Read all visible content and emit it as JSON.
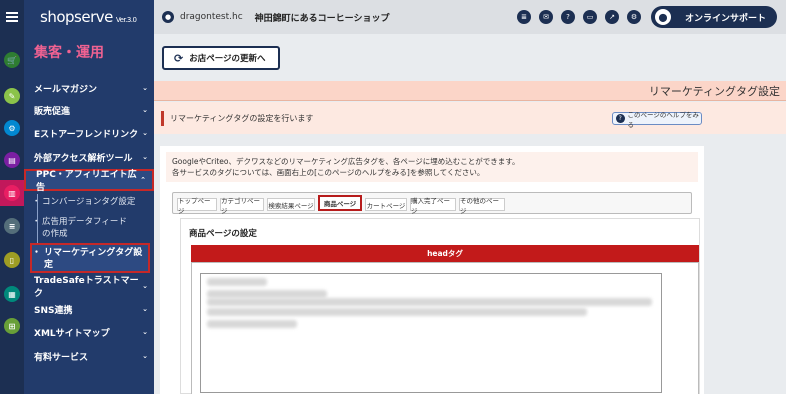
{
  "brand": {
    "name": "shopserve",
    "version": "Ver.3.0"
  },
  "section_title": "集客・運用",
  "header": {
    "user": "dragontest.hc",
    "shop": "神田錦町にあるコーヒーショップ",
    "support_label": "オンラインサポート",
    "icons": [
      "database-icon",
      "mail-icon",
      "help-icon",
      "chat-icon",
      "external-icon",
      "gear-icon"
    ]
  },
  "sidebar": {
    "items": [
      {
        "label": "メールマガジン",
        "chevron": "⌄"
      },
      {
        "label": "販売促進",
        "chevron": "⌄"
      },
      {
        "label": "Eストアーフレンドリンク",
        "chevron": "⌄"
      },
      {
        "label": "外部アクセス解析ツール",
        "chevron": "⌄"
      },
      {
        "label": "PPC・アフィリエイト広告",
        "chevron": "⌃"
      },
      {
        "label": "TradeSafeトラストマーク",
        "chevron": "⌄"
      },
      {
        "label": "SNS連携",
        "chevron": "⌄"
      },
      {
        "label": "XMLサイトマップ",
        "chevron": "⌄"
      },
      {
        "label": "有料サービス",
        "chevron": "⌄"
      }
    ],
    "sub_items": [
      {
        "label": "コンバージョンタグ設定"
      },
      {
        "label": "広告用データフィードの作成"
      },
      {
        "label": "リマーケティングタグ設定"
      }
    ]
  },
  "main": {
    "refresh_label": "お店ページの更新へ",
    "title": "リマーケティングタグ設定",
    "info": "リマーケティングタグの設定を行います",
    "help_label": "このページのヘルプをみる",
    "description_line1": "GoogleやCriteo、デクワスなどのリマーケティング広告タグを、各ページに埋め込むことができます。",
    "description_line2": "各サービスのタグについては、画面右上の[このページのヘルプをみる]を参照してください。",
    "tabs": [
      {
        "label": "トップページ"
      },
      {
        "label": "カテゴリページ"
      },
      {
        "label": "検索結果ページ"
      },
      {
        "label": "商品ページ"
      },
      {
        "label": "カートページ"
      },
      {
        "label": "購入完了ページ"
      },
      {
        "label": "その他のページ"
      }
    ],
    "active_tab": "商品ページ",
    "setting_title": "商品ページの設定",
    "head_tag_label": "headタグ"
  },
  "colors": {
    "rail": "#1c2f52",
    "sidebar": "#223b6b",
    "accent_pink": "#f06292",
    "highlight_red": "#c62828",
    "head_bar": "#c21a1a",
    "title_band": "#fbd5c8"
  }
}
